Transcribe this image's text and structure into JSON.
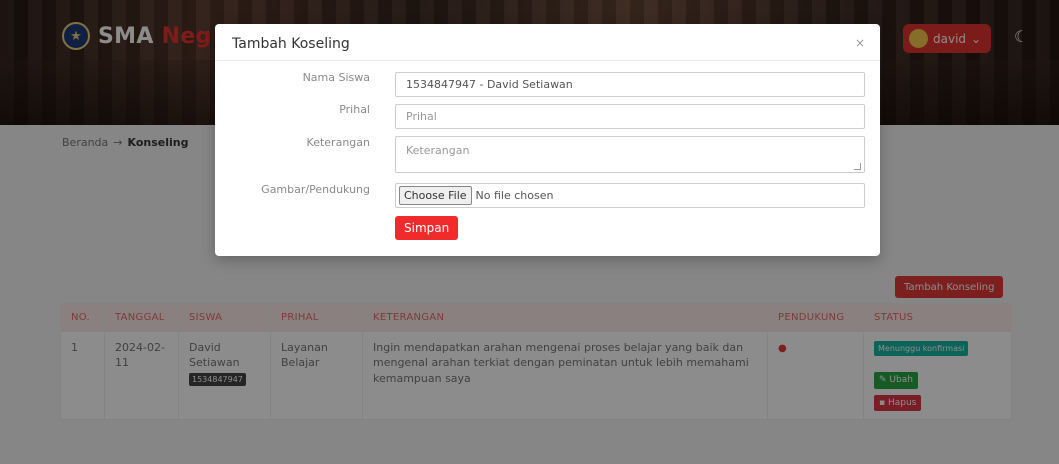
{
  "brand": {
    "name_prefix": "SMA ",
    "name_accent": "Neg"
  },
  "user": {
    "name": "david",
    "caret": "⌄"
  },
  "breadcrumb": {
    "home": "Beranda",
    "current": "Konseling"
  },
  "add_button": "Tambah Konseling",
  "table": {
    "headers": [
      "NO.",
      "TANGGAL",
      "SISWA",
      "PRIHAL",
      "KETERANGAN",
      "PENDUKUNG",
      "STATUS"
    ],
    "rows": [
      {
        "no": "1",
        "date_line1": "2024-02-",
        "date_line2": "11",
        "student_line1": "David",
        "student_line2": "Setiawan",
        "nis": "1534847947",
        "prihal_line1": "Layanan",
        "prihal_line2": "Belajar",
        "keterangan": "Ingin mendapatkan arahan mengenai proses belajar yang baik dan mengenal arahan terkiat dengan peminatan untuk lebih memahami kemampuan saya",
        "status": "Menunggu konfirmasi",
        "edit_label": "Ubah",
        "delete_label": "Hapus"
      }
    ]
  },
  "modal": {
    "title": "Tambah Koseling",
    "close": "×",
    "fields": {
      "nama_label": "Nama Siswa",
      "nama_value": "1534847947 - David Setiawan",
      "prihal_label": "Prihal",
      "prihal_placeholder": "Prihal",
      "ket_label": "Keterangan",
      "ket_placeholder": "Keterangan",
      "gambar_label": "Gambar/Pendukung",
      "file_button": "Choose File",
      "file_status": "No file chosen"
    },
    "save": "Simpan"
  },
  "icons": {
    "logo": "school-crest-icon",
    "theme": "moon-icon",
    "eye": "eye-icon",
    "edit": "edit-icon",
    "trash": "trash-icon"
  },
  "colors": {
    "accent": "#e23430",
    "status": "#17b5a0",
    "edit": "#28a745",
    "delete": "#dc3545"
  }
}
